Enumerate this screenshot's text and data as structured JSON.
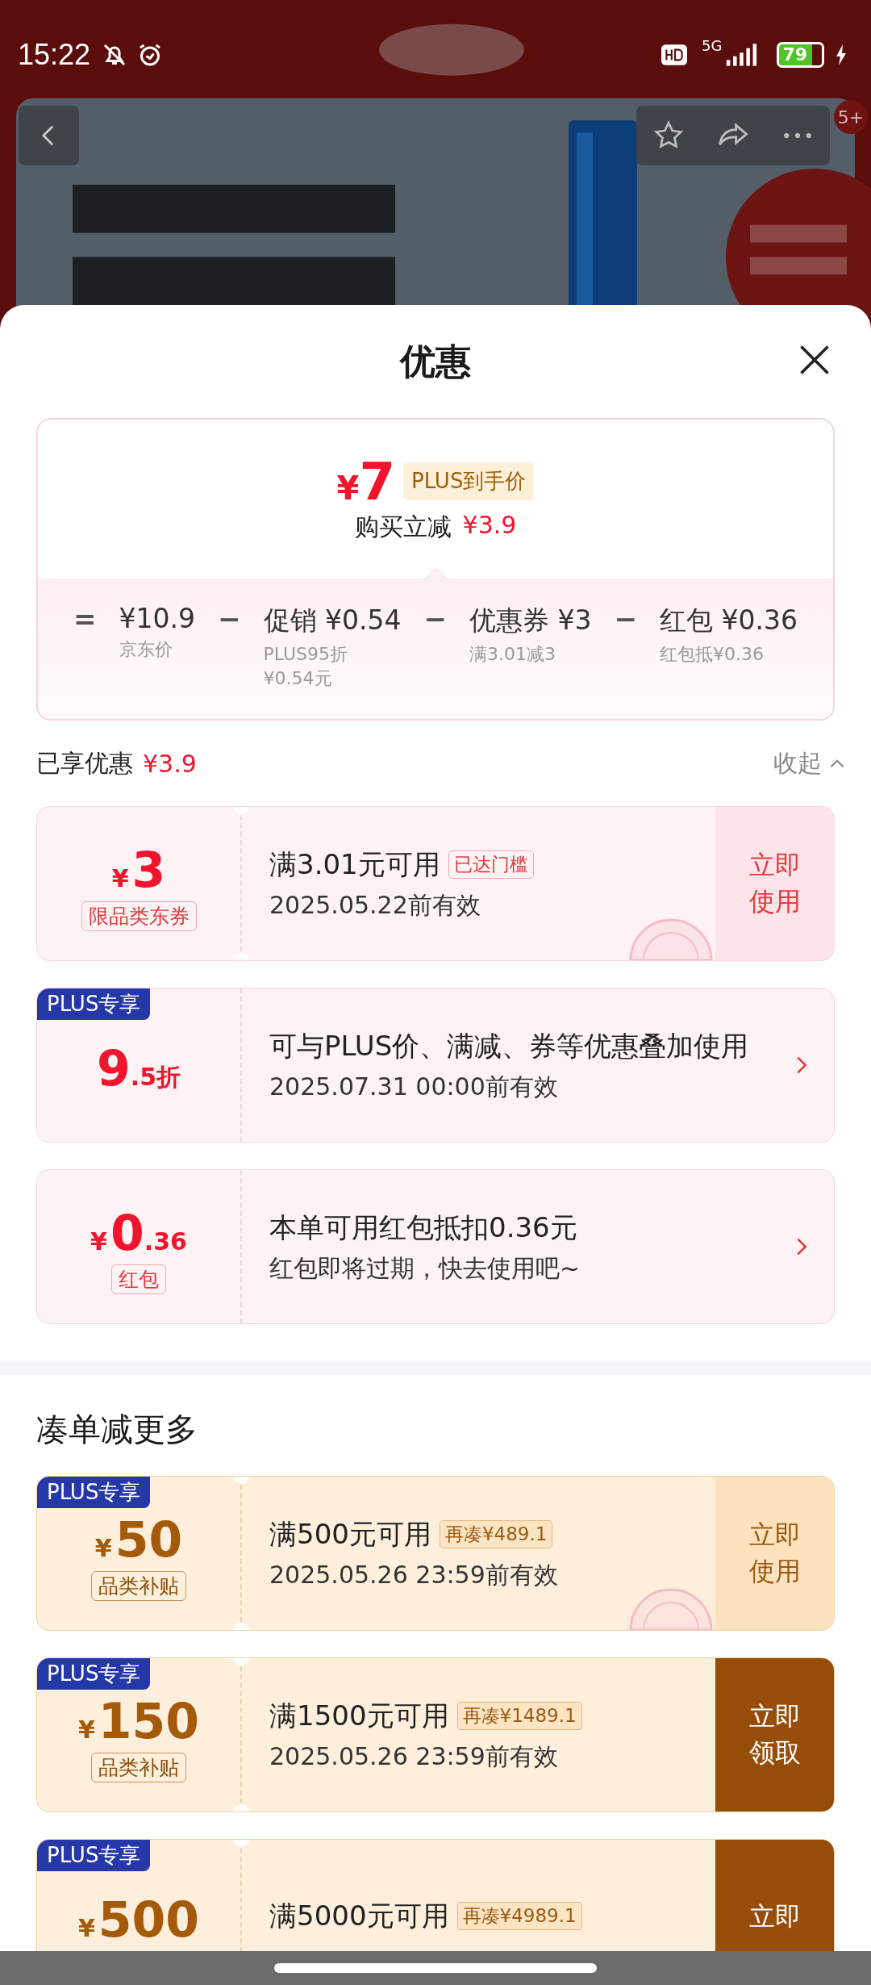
{
  "status_bar": {
    "time": "15:22",
    "network": "5G",
    "battery": "79"
  },
  "nav": {
    "badge": "5+"
  },
  "sheet": {
    "title": "优惠"
  },
  "summary": {
    "currency": "¥",
    "price": "7",
    "price_tag": "PLUS到手价",
    "saving_label": "购买立减",
    "saving": "¥3.9",
    "breakdown": [
      {
        "kind": "op",
        "symbol": "="
      },
      {
        "kind": "term",
        "amount": "¥10.9",
        "note": "京东价"
      },
      {
        "kind": "op",
        "symbol": "−"
      },
      {
        "kind": "term",
        "label": "促销",
        "amount": "¥0.54",
        "note": "PLUS95折 ¥0.54元"
      },
      {
        "kind": "op",
        "symbol": "−"
      },
      {
        "kind": "term",
        "label": "优惠券",
        "amount": "¥3",
        "note": "满3.01减3"
      },
      {
        "kind": "op",
        "symbol": "−"
      },
      {
        "kind": "term",
        "label": "红包",
        "amount": "¥0.36",
        "note": "红包抵¥0.36"
      }
    ]
  },
  "enjoyed": {
    "label": "已享优惠",
    "amount": "¥3.9",
    "toggle": "收起",
    "expanded": true
  },
  "coupons": [
    {
      "color": "#f0142c",
      "currency": "¥",
      "whole": "3",
      "tag": "限品类东券",
      "title": "满3.01元可用",
      "condition": "已达门槛",
      "validity": "2025.05.22前有效",
      "action": {
        "kind": "button",
        "label": "立即使用",
        "filled": false
      },
      "claimed": true
    },
    {
      "color": "#f0142c",
      "badge": "PLUS专享",
      "whole": "9",
      "fraction": ".5折",
      "title": "可与PLUS价、满减、券等优惠叠加使用",
      "validity": "2025.07.31 00:00前有效",
      "action": {
        "kind": "chevron"
      }
    },
    {
      "color": "#f0142c",
      "currency": "¥",
      "whole": "0",
      "fraction": ".36",
      "tag": "红包",
      "title": "本单可用红包抵扣0.36元",
      "validity": "红包即将过期，快去使用吧~",
      "action": {
        "kind": "chevron"
      }
    }
  ],
  "more": {
    "title": "凑单减更多",
    "coupons": [
      {
        "color": "#a45a08",
        "badge": "PLUS专享",
        "currency": "¥",
        "whole": "50",
        "tag": "品类补贴",
        "title": "满500元可用",
        "condition": "再凑¥489.1",
        "validity": "2025.05.26 23:59前有效",
        "action": {
          "kind": "button",
          "label": "立即使用",
          "filled": false
        },
        "claimed": true
      },
      {
        "color": "#a45a08",
        "badge": "PLUS专享",
        "currency": "¥",
        "whole": "150",
        "tag": "品类补贴",
        "title": "满1500元可用",
        "condition": "再凑¥1489.1",
        "validity": "2025.05.26 23:59前有效",
        "action": {
          "kind": "button",
          "label": "立即领取",
          "filled": true
        }
      },
      {
        "color": "#a45a08",
        "badge": "PLUS专享",
        "currency": "¥",
        "whole": "500",
        "title": "满5000元可用",
        "condition": "再凑¥4989.1",
        "action": {
          "kind": "button",
          "label": "立即",
          "filled": true
        }
      }
    ]
  }
}
